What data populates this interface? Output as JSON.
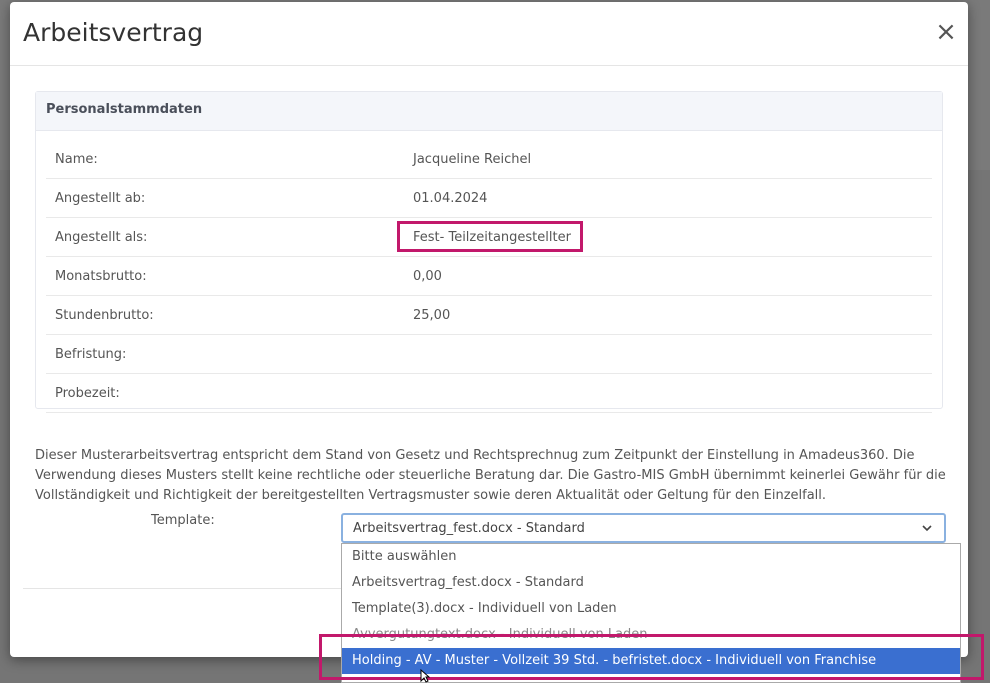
{
  "modal": {
    "title": "Arbeitsvertrag",
    "close_label": "×"
  },
  "panel": {
    "heading": "Personalstammdaten",
    "rows": [
      {
        "label": "Name:",
        "value": "Jacqueline Reichel"
      },
      {
        "label": "Angestellt ab:",
        "value": "01.04.2024"
      },
      {
        "label": "Angestellt als:",
        "value": "Fest- Teilzeitangestellter"
      },
      {
        "label": "Monatsbrutto:",
        "value": "0,00"
      },
      {
        "label": "Stundenbrutto:",
        "value": "25,00"
      },
      {
        "label": "Befristung:",
        "value": ""
      },
      {
        "label": "Probezeit:",
        "value": ""
      }
    ]
  },
  "disclaimer": "Dieser Musterarbeitsvertrag entspricht dem Stand von Gesetz und Rechtsprechnug zum Zeitpunkt der Einstellung in Amadeus360. Die Verwendung dieses Musters stellt keine rechtliche oder steuerliche Beratung dar. Die Gastro-MIS GmbH übernimmt keinerlei Gewähr für die Vollständigkeit und Richtigkeit der bereitgestellten Vertragsmuster sowie deren Aktualität oder Geltung für den Einzelfall.",
  "template": {
    "label": "Template:",
    "selected": "Arbeitsvertrag_fest.docx - Standard",
    "options": [
      "Bitte auswählen",
      "Arbeitsvertrag_fest.docx - Standard",
      "Template(3).docx - Individuell von Laden",
      "Avvergutungtext.docx - Individuell von Laden",
      "Holding - AV - Muster - Vollzeit 39 Std. - befristet.docx - Individuell von Franchise"
    ],
    "highlighted_option_index": 4
  },
  "colors": {
    "highlight_border": "#c2186b",
    "selected_option_bg": "#3a6fd0"
  }
}
